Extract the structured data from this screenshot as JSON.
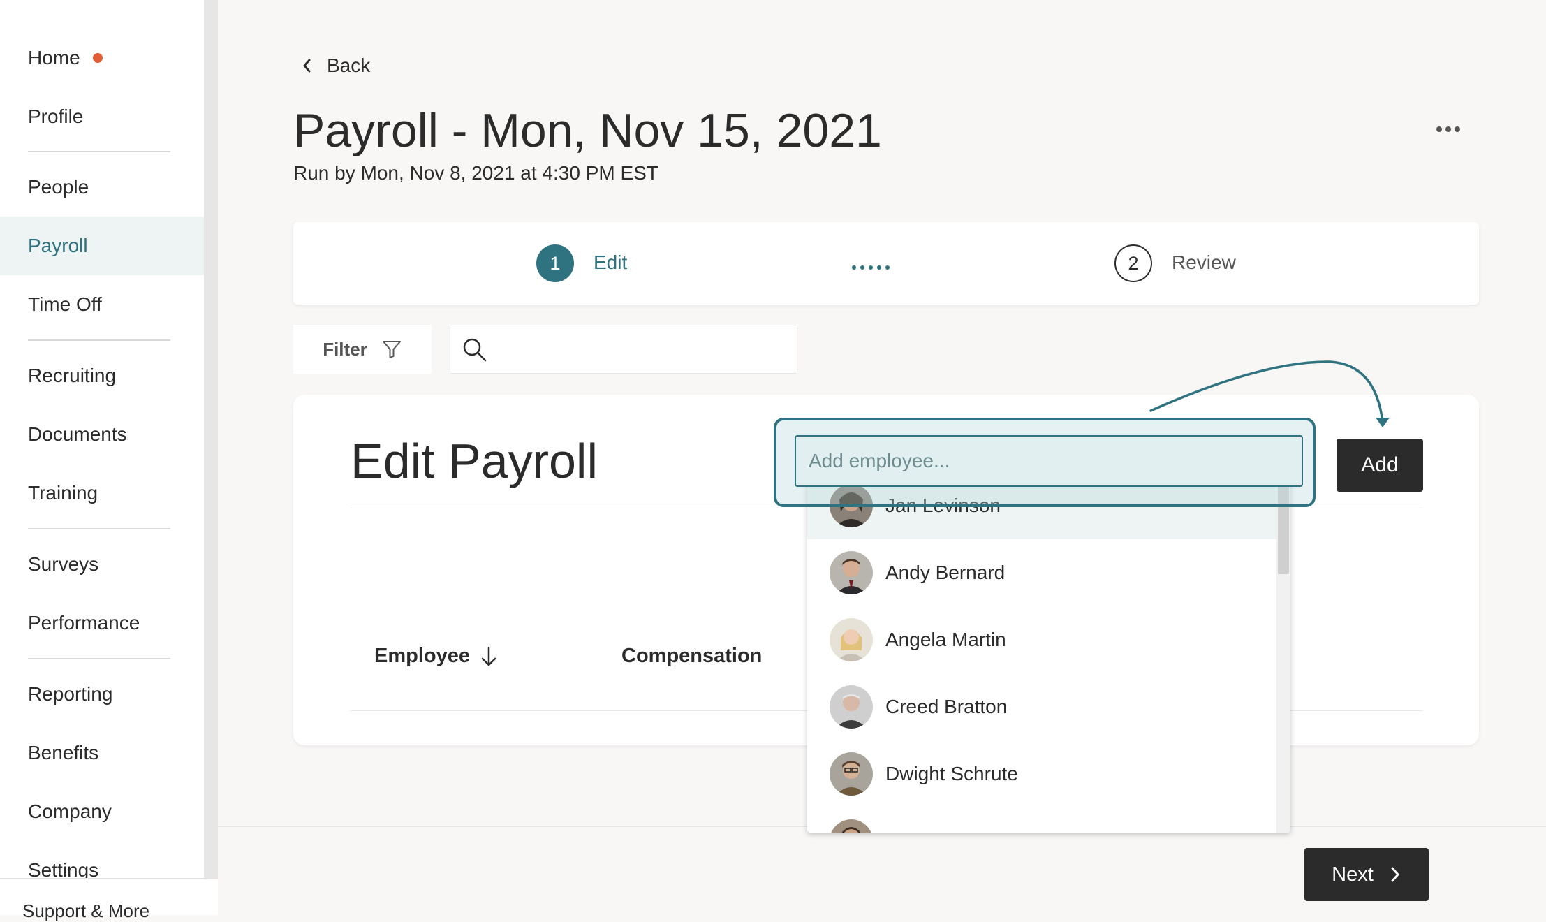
{
  "sidebar": {
    "items": [
      {
        "label": "Home",
        "notification": true
      },
      {
        "label": "Profile"
      },
      {
        "label": "People"
      },
      {
        "label": "Payroll",
        "active": true
      },
      {
        "label": "Time Off"
      },
      {
        "label": "Recruiting"
      },
      {
        "label": "Documents"
      },
      {
        "label": "Training"
      },
      {
        "label": "Surveys"
      },
      {
        "label": "Performance"
      },
      {
        "label": "Reporting"
      },
      {
        "label": "Benefits"
      },
      {
        "label": "Company"
      },
      {
        "label": "Settings"
      }
    ],
    "footer_label": "Support & More"
  },
  "header": {
    "back_label": "Back",
    "title": "Payroll - Mon, Nov 15, 2021",
    "subtitle": "Run by Mon, Nov 8, 2021 at 4:30 PM EST"
  },
  "stepper": {
    "steps": [
      {
        "number": "1",
        "label": "Edit",
        "active": true
      },
      {
        "number": "2",
        "label": "Review",
        "active": false
      }
    ]
  },
  "toolbar": {
    "filter_label": "Filter",
    "search_value": ""
  },
  "edit_payroll": {
    "title": "Edit Payroll",
    "add_placeholder": "Add employee...",
    "add_button": "Add",
    "columns": [
      "Employee",
      "Compensation"
    ]
  },
  "dropdown": {
    "options": [
      "Jan Levinson",
      "Andy Bernard",
      "Angela Martin",
      "Creed Bratton",
      "Dwight Schrute"
    ]
  },
  "footer": {
    "next_label": "Next"
  },
  "colors": {
    "accent": "#2f7280",
    "notification": "#e05d35",
    "dark_button": "#2b2b2b"
  }
}
